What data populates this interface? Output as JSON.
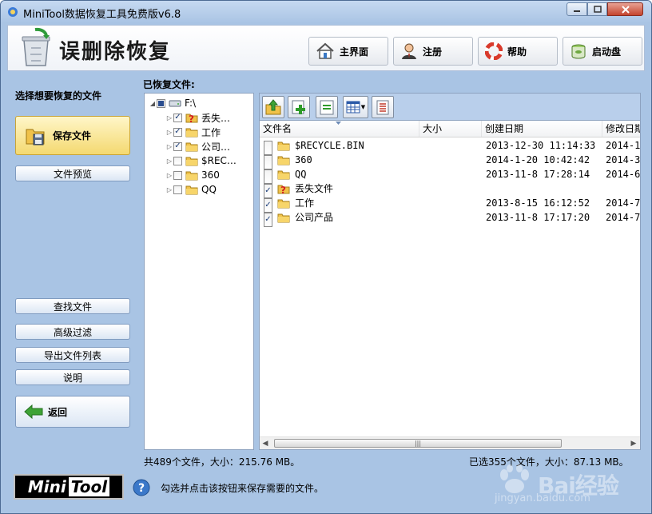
{
  "window": {
    "title": "MiniTool数据恢复工具免费版v6.8"
  },
  "header": {
    "title": "误删除恢复",
    "buttons": {
      "home": "主界面",
      "register": "注册",
      "help": "帮助",
      "bootdisk": "启动盘"
    }
  },
  "left": {
    "title": "选择想要恢复的文件",
    "save": "保存文件",
    "preview": "文件预览",
    "find": "查找文件",
    "filter": "高级过滤",
    "export": "导出文件列表",
    "desc": "说明",
    "back": "返回"
  },
  "recovered_label": "已恢复文件:",
  "tree": {
    "root": "F:\\",
    "items": [
      {
        "label": "丢失…",
        "checked": true,
        "icon": "lost-file-icon"
      },
      {
        "label": "工作",
        "checked": true,
        "icon": "folder-icon"
      },
      {
        "label": "公司…",
        "checked": true,
        "icon": "folder-icon"
      },
      {
        "label": "$REC…",
        "checked": false,
        "icon": "folder-icon"
      },
      {
        "label": "360",
        "checked": false,
        "icon": "folder-icon"
      },
      {
        "label": "QQ",
        "checked": false,
        "icon": "folder-icon"
      }
    ]
  },
  "list": {
    "columns": [
      "文件名",
      "大小",
      "创建日期",
      "修改日期"
    ],
    "rows": [
      {
        "name": "$RECYCLE.BIN",
        "size": "",
        "created": "2013-12-30 11:14:33",
        "modified": "2014-1-",
        "checked": false,
        "icon": "folder-icon"
      },
      {
        "name": "360",
        "size": "",
        "created": "2014-1-20 10:42:42",
        "modified": "2014-3-",
        "checked": false,
        "icon": "folder-icon"
      },
      {
        "name": "QQ",
        "size": "",
        "created": "2013-11-8 17:28:14",
        "modified": "2014-6-",
        "checked": false,
        "icon": "folder-icon"
      },
      {
        "name": "丢失文件",
        "size": "",
        "created": "",
        "modified": "",
        "checked": true,
        "icon": "lost-file-icon"
      },
      {
        "name": "工作",
        "size": "",
        "created": "2013-8-15 16:12:52",
        "modified": "2014-7-",
        "checked": true,
        "icon": "folder-icon"
      },
      {
        "name": "公司产品",
        "size": "",
        "created": "2013-11-8 17:17:20",
        "modified": "2014-7-",
        "checked": true,
        "icon": "folder-icon"
      }
    ]
  },
  "status": {
    "total": "共489个文件，大小：215.76 MB。",
    "selected": "已选355个文件，大小：87.13 MB。"
  },
  "footer": {
    "logo_mini": "Mini",
    "logo_tool": "Tool",
    "hint": "勾选并点击该按钮来保存需要的文件。"
  },
  "watermark": {
    "text": "Bai经验",
    "sub": "jingyan.baidu.com"
  },
  "colors": {
    "window_bg": "#a9c4e4",
    "save_button": "#f4d971",
    "accent": "#2a4d8f"
  }
}
